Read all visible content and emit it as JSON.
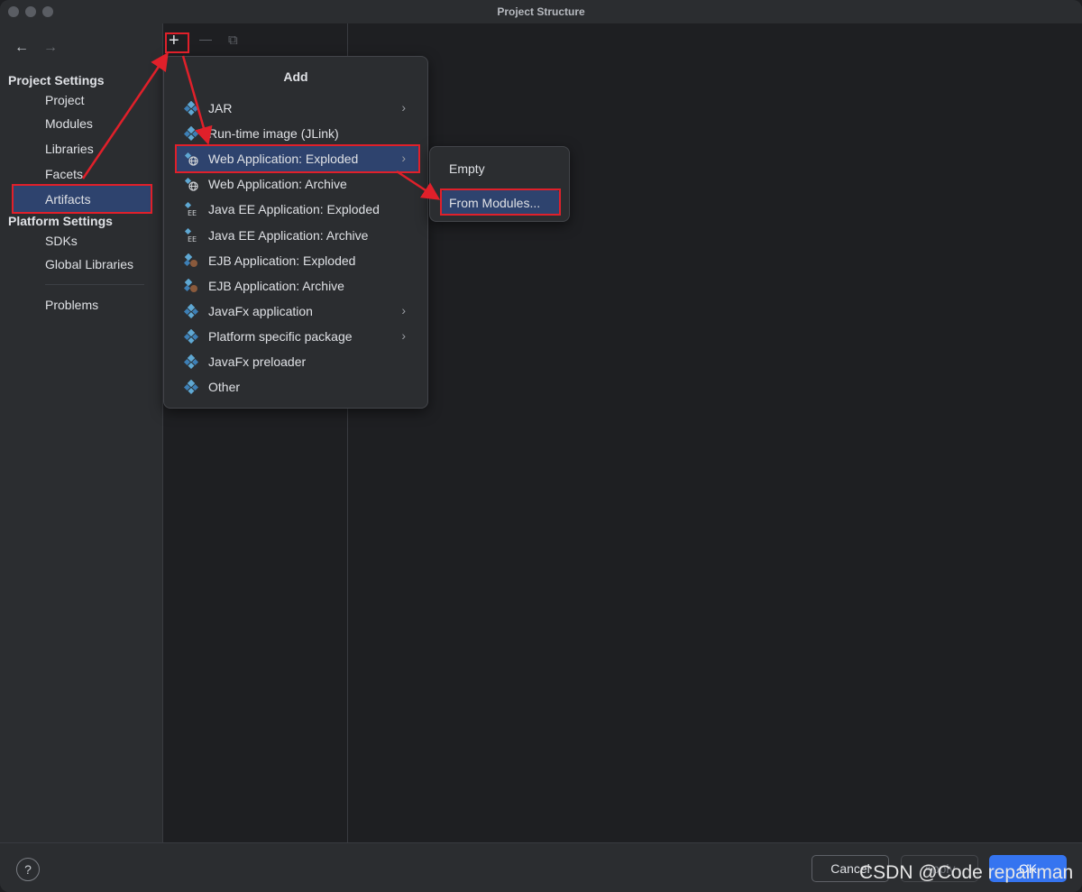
{
  "window": {
    "title": "Project Structure"
  },
  "nav": {
    "back_icon": "←",
    "forward_icon": "→"
  },
  "sidebar": {
    "project_settings_header": "Project Settings",
    "project_settings_items": [
      "Project",
      "Modules",
      "Libraries",
      "Facets",
      "Artifacts"
    ],
    "selected_item": "Artifacts",
    "platform_settings_header": "Platform Settings",
    "platform_settings_items": [
      "SDKs",
      "Global Libraries"
    ],
    "problems_label": "Problems"
  },
  "toolbar": {
    "add_icon": "+",
    "remove_icon": "—",
    "copy_icon": "⧉"
  },
  "add_menu": {
    "title": "Add",
    "items": [
      {
        "label": "JAR",
        "icon": "artifact-icon",
        "submenu": true
      },
      {
        "label": "Run-time image (JLink)",
        "icon": "artifact-icon",
        "submenu": false
      },
      {
        "label": "Web Application: Exploded",
        "icon": "web-artifact-icon",
        "submenu": true,
        "selected": true
      },
      {
        "label": "Web Application: Archive",
        "icon": "web-artifact-icon",
        "submenu": false
      },
      {
        "label": "Java EE Application: Exploded",
        "icon": "javaee-icon",
        "submenu": false
      },
      {
        "label": "Java EE Application: Archive",
        "icon": "javaee-icon",
        "submenu": false
      },
      {
        "label": "EJB Application: Exploded",
        "icon": "ejb-icon",
        "submenu": false
      },
      {
        "label": "EJB Application: Archive",
        "icon": "ejb-icon",
        "submenu": false
      },
      {
        "label": "JavaFx application",
        "icon": "artifact-icon",
        "submenu": true
      },
      {
        "label": "Platform specific package",
        "icon": "artifact-icon",
        "submenu": true
      },
      {
        "label": "JavaFx preloader",
        "icon": "artifact-icon",
        "submenu": false
      },
      {
        "label": "Other",
        "icon": "artifact-icon",
        "submenu": false
      }
    ]
  },
  "submenu": {
    "items": [
      {
        "label": "Empty"
      },
      {
        "label": "From Modules...",
        "selected": true
      }
    ]
  },
  "buttons": {
    "help": "?",
    "cancel": "Cancel",
    "apply": "Apply",
    "ok": "OK"
  },
  "watermark": "CSDN @Code repairman",
  "colors": {
    "selection": "#2e436e",
    "annotation": "#e0202a",
    "primary_button": "#3574f0"
  }
}
